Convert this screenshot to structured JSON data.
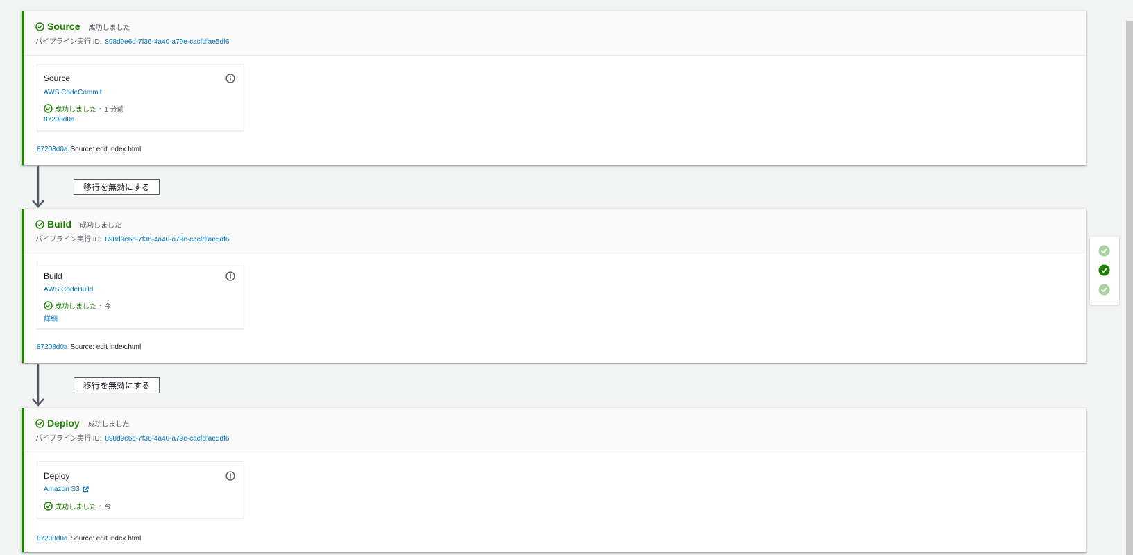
{
  "stages": [
    {
      "name": "Source",
      "status": "成功しました",
      "exec_label": "パイプライン実行 ID:",
      "exec_id": "898d9e6d-7f36-4a40-a79e-cacfdfae5df6",
      "action": {
        "name": "Source",
        "provider": "AWS CodeCommit",
        "status": "成功しました",
        "separator": "-",
        "time": "1 分前",
        "link": "87208d0a"
      },
      "commit_id": "87208d0a",
      "commit_message": "Source: edit index.html"
    },
    {
      "name": "Build",
      "status": "成功しました",
      "exec_label": "パイプライン実行 ID:",
      "exec_id": "898d9e6d-7f36-4a40-a79e-cacfdfae5df6",
      "action": {
        "name": "Build",
        "provider": "AWS CodeBuild",
        "status": "成功しました",
        "separator": "-",
        "time": "今",
        "link": "詳細"
      },
      "commit_id": "87208d0a",
      "commit_message": "Source: edit index.html"
    },
    {
      "name": "Deploy",
      "status": "成功しました",
      "exec_label": "パイプライン実行 ID:",
      "exec_id": "898d9e6d-7f36-4a40-a79e-cacfdfae5df6",
      "action": {
        "name": "Deploy",
        "provider": "Amazon S3",
        "status": "成功しました",
        "separator": "-",
        "time": "今"
      },
      "commit_id": "87208d0a",
      "commit_message": "Source: edit index.html"
    }
  ],
  "transitions": [
    {
      "button_label": "移行を無効にする"
    },
    {
      "button_label": "移行を無効にする"
    }
  ],
  "mini_nav": [
    "success",
    "success-current",
    "success"
  ],
  "colors": {
    "success": "#1d8102",
    "link": "#0073bb",
    "muted_success": "#a8d19f"
  }
}
